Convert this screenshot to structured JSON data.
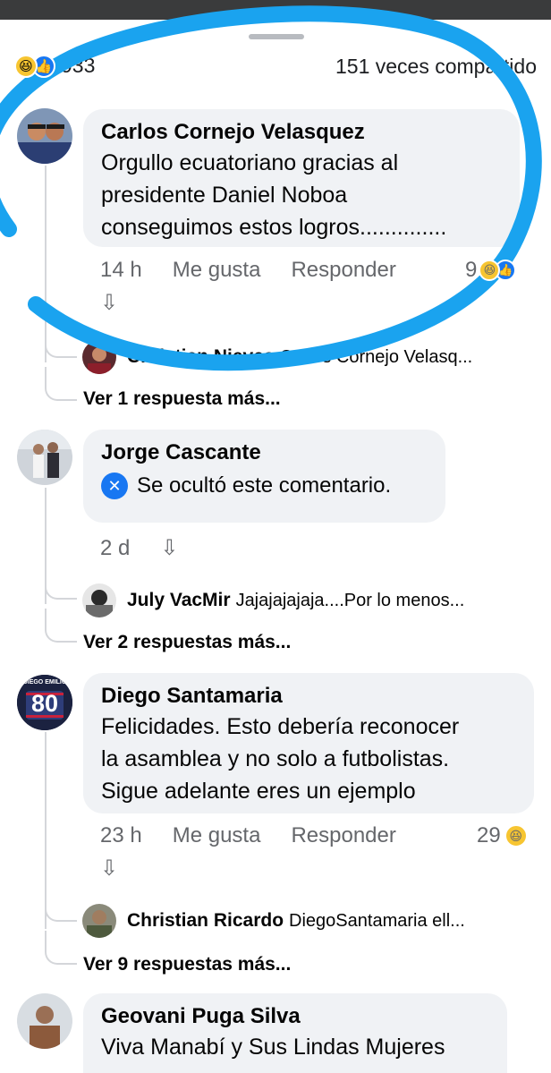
{
  "stats": {
    "reaction_count": "933",
    "shares_text": "151 veces compartido"
  },
  "comments": [
    {
      "author": "Carlos Cornejo Velasquez",
      "text": "Orgullo ecuatoriano gracias al\npresidente Daniel Noboa\nconseguimos estos logros..............",
      "time": "14 h",
      "like_label": "Me gusta",
      "reply_label": "Responder",
      "reaction_count": "9",
      "reply_preview": {
        "name": "Christian Nieves",
        "text": "Carlos Cornejo Velasq..."
      },
      "more_replies": "Ver 1 respuesta más..."
    },
    {
      "author": "Jorge Cascante",
      "hidden_text": "Se ocultó este comentario.",
      "time": "2 d",
      "reply_preview": {
        "name": "July VacMir",
        "text": "Jajajajajaja....Por lo menos..."
      },
      "more_replies": "Ver 2 respuestas más..."
    },
    {
      "author": "Diego Santamaria",
      "avatar_text": "80",
      "avatar_caption": "DIEGO EMILIO",
      "text": "Felicidades. Esto debería reconocer\nla asamblea y no solo a futbolistas.\nSigue adelante eres un ejemplo",
      "time": "23 h",
      "like_label": "Me gusta",
      "reply_label": "Responder",
      "reaction_count": "29",
      "reply_preview": {
        "name": "Christian Ricardo",
        "text": "DiegoSantamaria ell..."
      },
      "more_replies": "Ver 9 respuestas más..."
    },
    {
      "author": "Geovani Puga Silva",
      "text": "Viva Manabí y Sus Lindas Mujeres"
    }
  ],
  "colors": {
    "bubble": "#f0f2f5",
    "meta_text": "#65676b",
    "accent": "#1877f2",
    "annotation": "#1aa3ef"
  },
  "icons": {
    "haha": "haha-reaction-icon",
    "like": "like-reaction-icon",
    "arrow": "down-arrow-icon",
    "hidden": "hidden-comment-icon"
  }
}
